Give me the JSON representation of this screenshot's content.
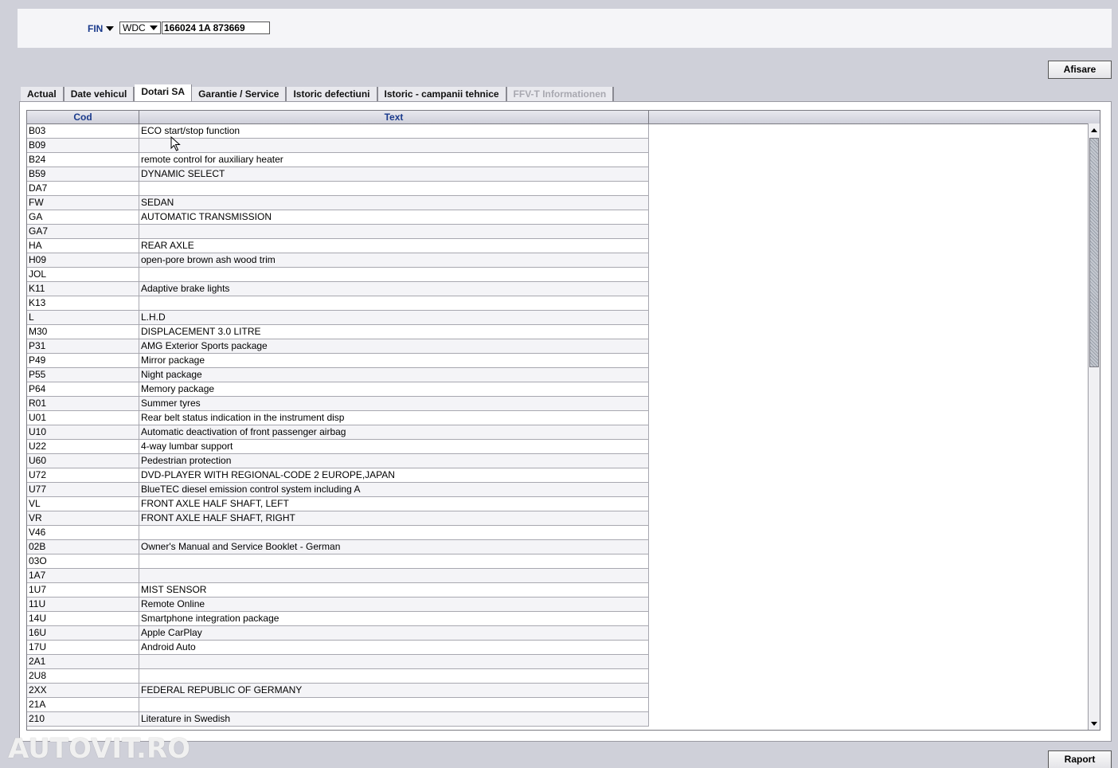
{
  "header": {
    "fin_label": "FIN",
    "wmi_value": "WDC",
    "vin_value": "166024 1A 873669"
  },
  "buttons": {
    "afisare": "Afisare",
    "raport": "Raport"
  },
  "tabs": [
    {
      "label": "Actual",
      "active": false,
      "disabled": false
    },
    {
      "label": "Date vehicul",
      "active": false,
      "disabled": false
    },
    {
      "label": "Dotari SA",
      "active": true,
      "disabled": false
    },
    {
      "label": "Garantie / Service",
      "active": false,
      "disabled": false
    },
    {
      "label": "Istoric defectiuni",
      "active": false,
      "disabled": false
    },
    {
      "label": "Istoric - campanii tehnice",
      "active": false,
      "disabled": false
    },
    {
      "label": "FFV-T Informationen",
      "active": false,
      "disabled": true
    }
  ],
  "table": {
    "columns": {
      "cod": "Cod",
      "text": "Text"
    },
    "rows": [
      {
        "cod": "B03",
        "text": "ECO start/stop function"
      },
      {
        "cod": "B09",
        "text": ""
      },
      {
        "cod": "B24",
        "text": "remote control for auxiliary heater"
      },
      {
        "cod": "B59",
        "text": "DYNAMIC SELECT"
      },
      {
        "cod": "DA7",
        "text": ""
      },
      {
        "cod": "FW",
        "text": "SEDAN"
      },
      {
        "cod": "GA",
        "text": "AUTOMATIC TRANSMISSION"
      },
      {
        "cod": "GA7",
        "text": ""
      },
      {
        "cod": "HA",
        "text": "REAR AXLE"
      },
      {
        "cod": "H09",
        "text": "open-pore brown ash wood trim"
      },
      {
        "cod": "JOL",
        "text": ""
      },
      {
        "cod": "K11",
        "text": "Adaptive brake lights"
      },
      {
        "cod": "K13",
        "text": ""
      },
      {
        "cod": "L",
        "text": "L.H.D"
      },
      {
        "cod": "M30",
        "text": "DISPLACEMENT 3.0 LITRE"
      },
      {
        "cod": "P31",
        "text": "AMG Exterior Sports package"
      },
      {
        "cod": "P49",
        "text": "Mirror package"
      },
      {
        "cod": "P55",
        "text": "Night package"
      },
      {
        "cod": "P64",
        "text": "Memory package"
      },
      {
        "cod": "R01",
        "text": "Summer tyres"
      },
      {
        "cod": "U01",
        "text": "Rear belt status indication in the instrument disp"
      },
      {
        "cod": "U10",
        "text": "Automatic deactivation of front passenger airbag"
      },
      {
        "cod": "U22",
        "text": "4-way lumbar support"
      },
      {
        "cod": "U60",
        "text": "Pedestrian protection"
      },
      {
        "cod": "U72",
        "text": "DVD-PLAYER WITH REGIONAL-CODE 2 EUROPE,JAPAN"
      },
      {
        "cod": "U77",
        "text": "BlueTEC diesel emission control system including A"
      },
      {
        "cod": "VL",
        "text": "FRONT AXLE HALF SHAFT, LEFT"
      },
      {
        "cod": "VR",
        "text": "FRONT AXLE HALF SHAFT, RIGHT"
      },
      {
        "cod": "V46",
        "text": ""
      },
      {
        "cod": "02B",
        "text": "Owner's Manual and Service Booklet - German"
      },
      {
        "cod": "03O",
        "text": ""
      },
      {
        "cod": "1A7",
        "text": ""
      },
      {
        "cod": "1U7",
        "text": "MIST SENSOR"
      },
      {
        "cod": "11U",
        "text": "Remote Online"
      },
      {
        "cod": "14U",
        "text": "Smartphone integration package"
      },
      {
        "cod": "16U",
        "text": "Apple CarPlay"
      },
      {
        "cod": "17U",
        "text": "Android Auto"
      },
      {
        "cod": "2A1",
        "text": ""
      },
      {
        "cod": "2U8",
        "text": ""
      },
      {
        "cod": "2XX",
        "text": "FEDERAL REPUBLIC OF GERMANY"
      },
      {
        "cod": "21A",
        "text": ""
      },
      {
        "cod": "210",
        "text": "Literature in Swedish"
      }
    ]
  },
  "watermark": "AUTOVIT.RO",
  "icons": {
    "fin_dropdown": "chevron-down-icon",
    "wmi_dropdown": "chevron-down-icon",
    "scroll_up": "arrow-up-icon",
    "scroll_down": "arrow-down-icon",
    "cursor": "mouse-pointer-icon"
  }
}
